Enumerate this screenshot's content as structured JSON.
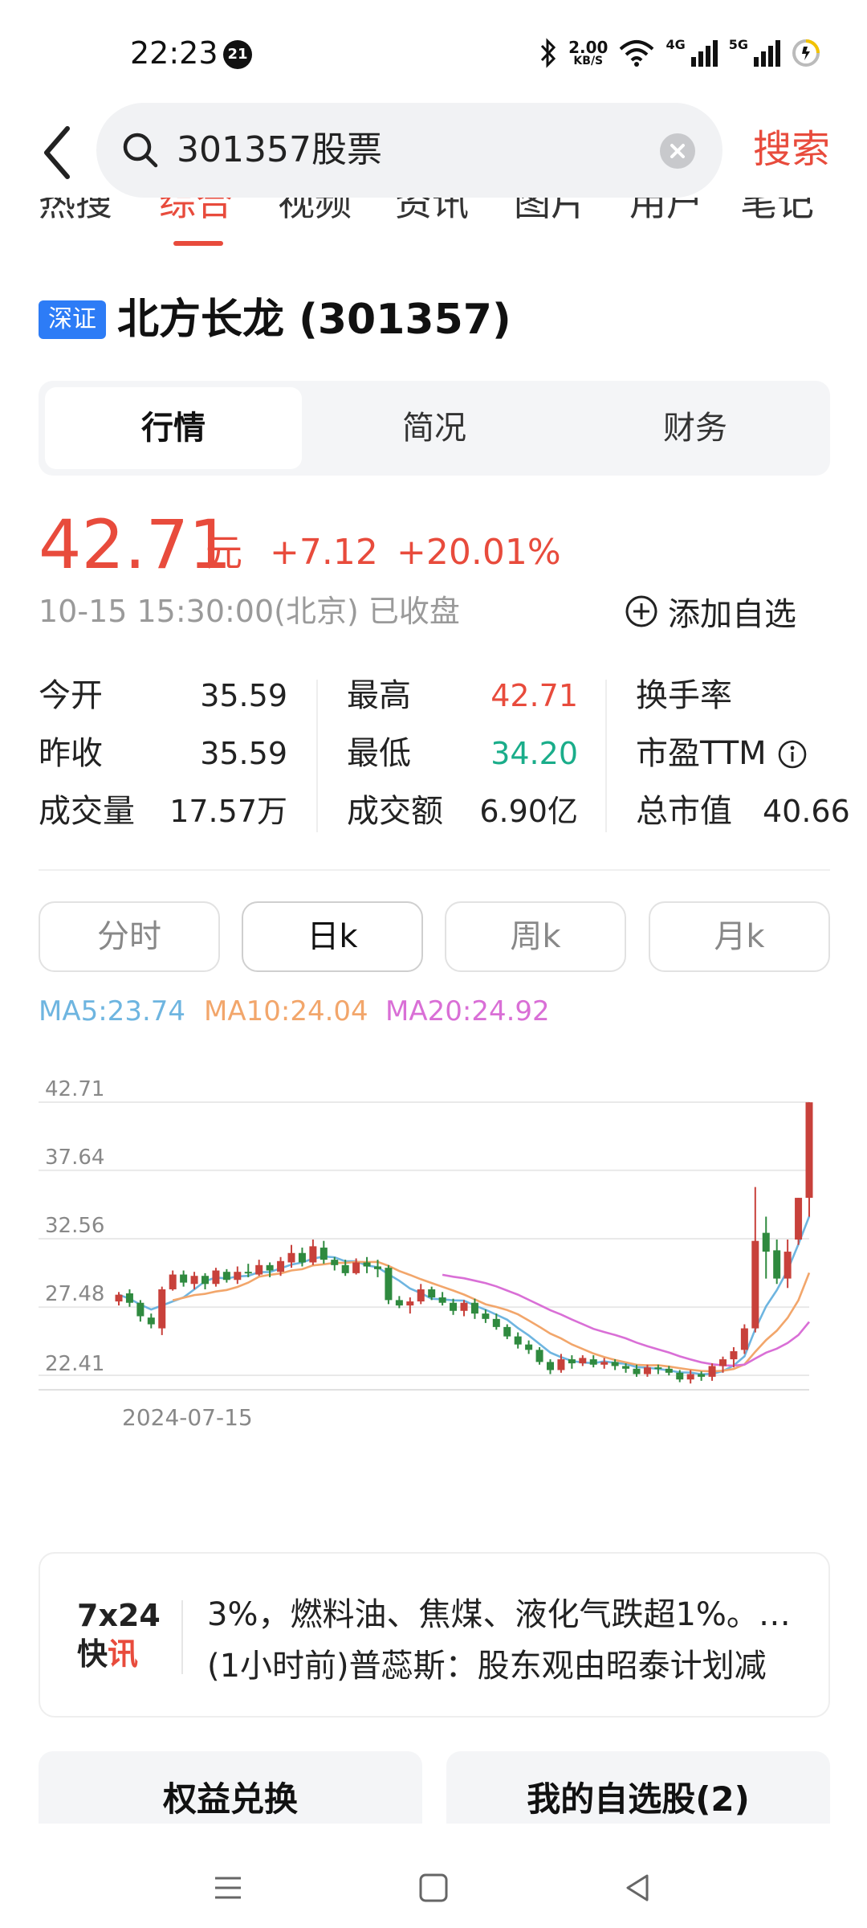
{
  "status_bar": {
    "time": "22:23",
    "notification_count": "21",
    "net_speed_value": "2.00",
    "net_speed_unit": "KB/S",
    "sim1_label": "4G",
    "sim2_label": "5G"
  },
  "search": {
    "query": "301357股票",
    "submit_label": "搜索"
  },
  "category_tabs": [
    {
      "label": "热搜"
    },
    {
      "label": "综合"
    },
    {
      "label": "视频"
    },
    {
      "label": "资讯"
    },
    {
      "label": "图片"
    },
    {
      "label": "用户"
    },
    {
      "label": "笔记"
    }
  ],
  "stock": {
    "exchange": "深证",
    "title": "北方长龙 (301357)"
  },
  "detail_tabs": [
    {
      "label": "行情"
    },
    {
      "label": "简况"
    },
    {
      "label": "财务"
    }
  ],
  "quote": {
    "price": "42.71",
    "unit": "元",
    "change": "+7.12",
    "change_pct": "+20.01%",
    "time_status": "10-15 15:30:00(北京) 已收盘",
    "add_watch_label": "添加自选"
  },
  "stats": {
    "open_label": "今开",
    "open": "35.59",
    "prev_close_label": "昨收",
    "prev_close": "35.59",
    "volume_label": "成交量",
    "volume": "17.57万",
    "high_label": "最高",
    "high": "42.71",
    "low_label": "最低",
    "low": "34.20",
    "amount_label": "成交额",
    "amount": "6.90亿",
    "turnover_label": "换手率",
    "pe_label": "市盈TTM",
    "market_cap_label": "总市值",
    "market_cap": "40.66"
  },
  "period_tabs": [
    {
      "label": "分时"
    },
    {
      "label": "日k"
    },
    {
      "label": "周k"
    },
    {
      "label": "月k"
    }
  ],
  "ma_legend": {
    "ma5": "MA5:23.74",
    "ma10": "MA10:24.04",
    "ma20": "MA20:24.92"
  },
  "colors": {
    "up": "#c8413b",
    "down": "#2f8a3f",
    "ma5": "#6eb5e0",
    "ma10": "#f2a66b",
    "ma20": "#d96fd6",
    "accent": "#e84b3c"
  },
  "chart_data": {
    "type": "candlestick",
    "y_ticks": [
      "42.71",
      "37.64",
      "32.56",
      "27.48",
      "22.41"
    ],
    "ylim": [
      22.41,
      42.71
    ],
    "x_label_start": "2024-07-15",
    "candles": [
      [
        27.9,
        28.4,
        27.6,
        28.6
      ],
      [
        28.5,
        27.8,
        27.5,
        28.8
      ],
      [
        27.8,
        26.8,
        26.4,
        28.0
      ],
      [
        26.7,
        26.2,
        25.9,
        27.0
      ],
      [
        25.9,
        28.8,
        25.4,
        29.0
      ],
      [
        28.8,
        29.9,
        28.7,
        30.2
      ],
      [
        29.9,
        29.3,
        29.0,
        30.2
      ],
      [
        29.2,
        29.8,
        28.8,
        30.1
      ],
      [
        29.8,
        29.2,
        28.8,
        30.0
      ],
      [
        29.2,
        30.2,
        29.0,
        30.4
      ],
      [
        30.1,
        29.5,
        29.3,
        30.3
      ],
      [
        29.5,
        30.1,
        29.2,
        30.5
      ],
      [
        30.1,
        30.0,
        29.7,
        30.7
      ],
      [
        29.9,
        30.6,
        29.8,
        31.0
      ],
      [
        30.6,
        30.2,
        29.7,
        30.8
      ],
      [
        30.1,
        30.9,
        29.8,
        31.2
      ],
      [
        30.8,
        31.5,
        30.4,
        32.1
      ],
      [
        31.5,
        30.8,
        30.5,
        31.9
      ],
      [
        30.8,
        32.0,
        30.6,
        32.5
      ],
      [
        31.9,
        31.0,
        30.7,
        32.4
      ],
      [
        31.0,
        30.6,
        30.2,
        31.2
      ],
      [
        30.6,
        30.0,
        29.8,
        31.0
      ],
      [
        30.0,
        30.8,
        29.9,
        31.1
      ],
      [
        30.8,
        30.5,
        30.0,
        31.2
      ],
      [
        30.5,
        30.3,
        29.7,
        31.0
      ],
      [
        30.4,
        28.0,
        27.7,
        30.6
      ],
      [
        28.0,
        27.6,
        27.4,
        28.3
      ],
      [
        27.6,
        27.9,
        27.0,
        28.2
      ],
      [
        27.9,
        28.8,
        27.7,
        29.2
      ],
      [
        28.8,
        28.2,
        28.0,
        29.0
      ],
      [
        28.2,
        27.8,
        27.6,
        28.6
      ],
      [
        27.8,
        27.2,
        26.9,
        28.1
      ],
      [
        27.2,
        27.8,
        26.8,
        28.0
      ],
      [
        27.8,
        27.0,
        26.6,
        28.1
      ],
      [
        27.0,
        26.6,
        26.3,
        27.3
      ],
      [
        26.6,
        26.0,
        25.8,
        27.0
      ],
      [
        26.0,
        25.3,
        25.1,
        26.2
      ],
      [
        25.3,
        24.7,
        24.4,
        25.6
      ],
      [
        24.7,
        24.3,
        24.0,
        25.0
      ],
      [
        24.3,
        23.4,
        23.2,
        24.5
      ],
      [
        23.4,
        22.8,
        22.5,
        23.6
      ],
      [
        22.8,
        23.6,
        22.6,
        24.0
      ],
      [
        23.6,
        23.3,
        22.9,
        23.9
      ],
      [
        23.3,
        23.7,
        23.1,
        23.9
      ],
      [
        23.6,
        23.2,
        23.0,
        23.9
      ],
      [
        23.2,
        23.4,
        22.9,
        23.7
      ],
      [
        23.4,
        23.1,
        22.8,
        23.6
      ],
      [
        23.1,
        22.9,
        22.6,
        23.3
      ],
      [
        22.9,
        22.5,
        22.3,
        23.2
      ],
      [
        22.5,
        23.0,
        22.3,
        23.2
      ],
      [
        23.0,
        22.9,
        22.5,
        23.2
      ],
      [
        22.9,
        22.6,
        22.4,
        23.1
      ],
      [
        22.6,
        22.1,
        21.9,
        22.8
      ],
      [
        22.1,
        22.5,
        21.8,
        22.8
      ],
      [
        22.5,
        22.3,
        22.0,
        22.7
      ],
      [
        22.3,
        23.1,
        22.0,
        23.3
      ],
      [
        23.1,
        23.6,
        22.6,
        23.8
      ],
      [
        23.6,
        24.2,
        23.0,
        24.5
      ],
      [
        24.3,
        25.9,
        24.0,
        26.2
      ],
      [
        25.9,
        32.4,
        25.6,
        36.4
      ],
      [
        33.0,
        31.6,
        29.6,
        34.2
      ],
      [
        31.7,
        29.6,
        29.2,
        32.5
      ],
      [
        29.6,
        31.6,
        28.9,
        32.5
      ],
      [
        32.5,
        35.6,
        32.1,
        35.6
      ],
      [
        35.6,
        42.7,
        34.2,
        42.7
      ]
    ]
  },
  "news": {
    "logo_top": "7x24",
    "logo_bottom_a": "快",
    "logo_bottom_b": "讯",
    "line1": "3%，燃料油、焦煤、液化气跌超1%。…",
    "line2": "(1小时前)普蕊斯：股东观由昭泰计划减"
  },
  "bottom_buttons": {
    "left": "权益兑换",
    "right": "我的自选股(2)"
  }
}
